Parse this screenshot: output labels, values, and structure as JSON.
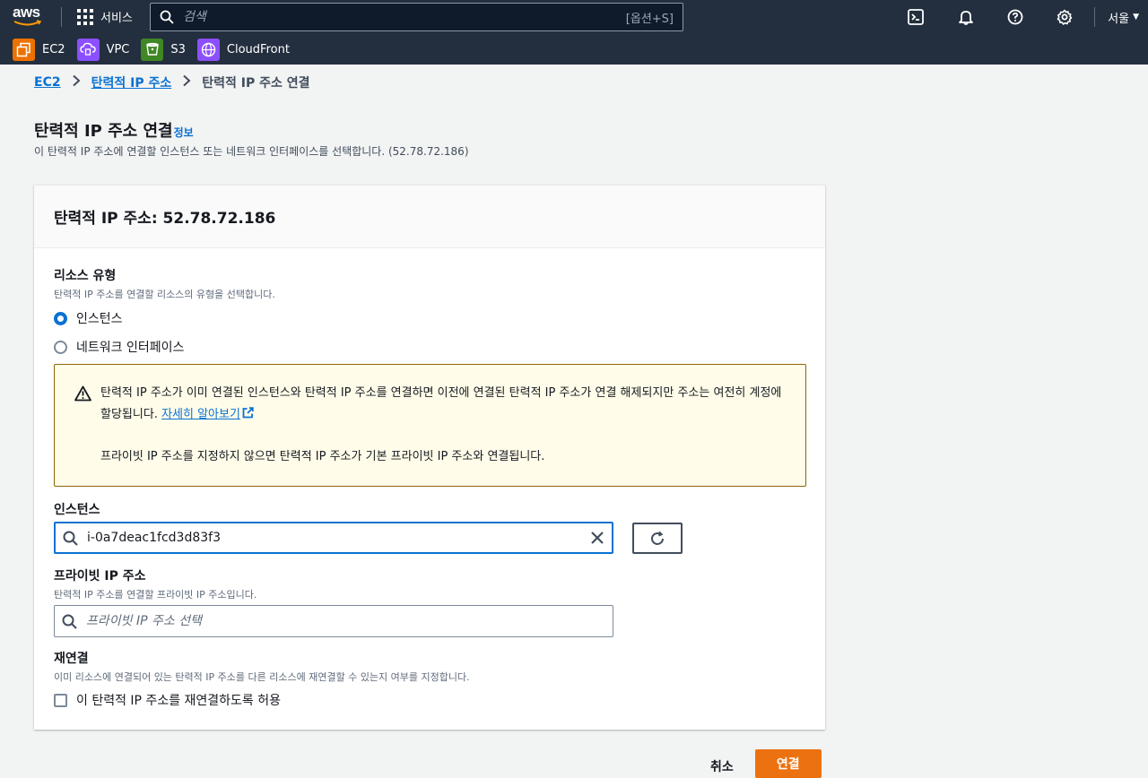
{
  "nav": {
    "logo": "aws",
    "services_label": "서비스",
    "search_placeholder": "검색",
    "search_shortcut": "[옵션+S]",
    "region": "서울"
  },
  "favorites": [
    {
      "label": "EC2",
      "color": "#ed7100",
      "icon": "ec2-icon"
    },
    {
      "label": "VPC",
      "color": "#8c4fff",
      "icon": "vpc-icon"
    },
    {
      "label": "S3",
      "color": "#3f8624",
      "icon": "s3-icon"
    },
    {
      "label": "CloudFront",
      "color": "#8c4fff",
      "icon": "cloudfront-icon"
    }
  ],
  "breadcrumb": {
    "items": [
      "EC2",
      "탄력적 IP 주소"
    ],
    "current": "탄력적 IP 주소 연결"
  },
  "header": {
    "title": "탄력적 IP 주소 연결",
    "info": "정보",
    "description": "이 탄력적 IP 주소에 연결할 인스턴스 또는 네트워크 인터페이스를 선택합니다. (52.78.72.186)"
  },
  "panel": {
    "title": "탄력적 IP 주소: 52.78.72.186",
    "resource_type": {
      "label": "리소스 유형",
      "description": "탄력적 IP 주소를 연결할 리소스의 유형을 선택합니다.",
      "options": [
        "인스턴스",
        "네트워크 인터페이스"
      ],
      "selected": "인스턴스"
    },
    "alert": {
      "text1": "탄력적 IP 주소가 이미 연결된 인스턴스와 탄력적 IP 주소를 연결하면 이전에 연결된 탄력적 IP 주소가 연결 해제되지만 주소는 여전히 계정에 할당됩니다.",
      "link": "자세히 알아보기",
      "text2": "프라이빗 IP 주소를 지정하지 않으면 탄력적 IP 주소가 기본 프라이빗 IP 주소와 연결됩니다."
    },
    "instance": {
      "label": "인스턴스",
      "value": "i-0a7deac1fcd3d83f3"
    },
    "private_ip": {
      "label": "프라이빗 IP 주소",
      "description": "탄력적 IP 주소를 연결할 프라이빗 IP 주소입니다.",
      "placeholder": "프라이빗 IP 주소 선택"
    },
    "reassociation": {
      "label": "재연결",
      "description": "이미 리소스에 연결되어 있는 탄력적 IP 주소를 다른 리소스에 재연결할 수 있는지 여부를 지정합니다.",
      "checkbox_label": "이 탄력적 IP 주소를 재연결하도록 허용"
    }
  },
  "actions": {
    "cancel": "취소",
    "associate": "연결"
  }
}
